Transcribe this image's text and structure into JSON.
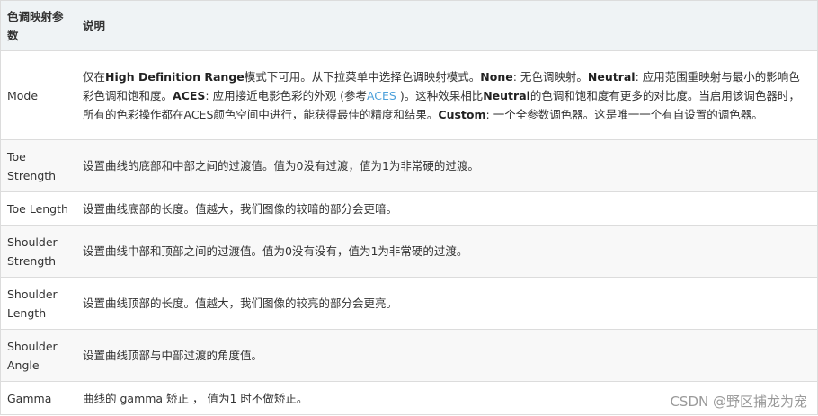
{
  "table": {
    "header": {
      "col1": "色调映射参数",
      "col2": "说明"
    },
    "mode": {
      "name": "Mode",
      "t1": "仅在",
      "b1": "High Definition Range",
      "t2": "模式下可用。从下拉菜单中选择色调映射模式。",
      "b2": "None",
      "t3": ": 无色调映射。",
      "b3": "Neutral",
      "t4": ": 应用范围重映射与最小的影响色彩色调和饱和度。",
      "b4": "ACES",
      "t5": ": 应用接近电影色彩的外观 (参考",
      "link": "ACES",
      "t6": " )。这种效果相比",
      "b5": "Neutral",
      "t7": "的色调和饱和度有更多的对比度。当启用该调色器时，所有的色彩操作都在ACES颜色空间中进行，能获得最佳的精度和结果。",
      "b6": "Custom",
      "t8": ": 一个全参数调色器。这是唯一一个有自设置的调色器。"
    },
    "rows": [
      {
        "name": "Toe Strength",
        "desc": "设置曲线的底部和中部之间的过渡值。值为0没有过渡，值为1为非常硬的过渡。"
      },
      {
        "name": "Toe Length",
        "desc": "设置曲线底部的长度。值越大，我们图像的较暗的部分会更暗。"
      },
      {
        "name": "Shoulder Strength",
        "desc": "设置曲线中部和顶部之间的过渡值。值为0没有没有，值为1为非常硬的过渡。"
      },
      {
        "name": "Shoulder Length",
        "desc": "设置曲线顶部的长度。值越大，我们图像的较亮的部分会更亮。"
      },
      {
        "name": "Shoulder Angle",
        "desc": "设置曲线顶部与中部过渡的角度值。"
      },
      {
        "name": "Gamma",
        "desc": "曲线的 gamma 矫正 ， 值为1 时不做矫正。"
      }
    ]
  },
  "watermark": "CSDN @野区捕龙为宠"
}
